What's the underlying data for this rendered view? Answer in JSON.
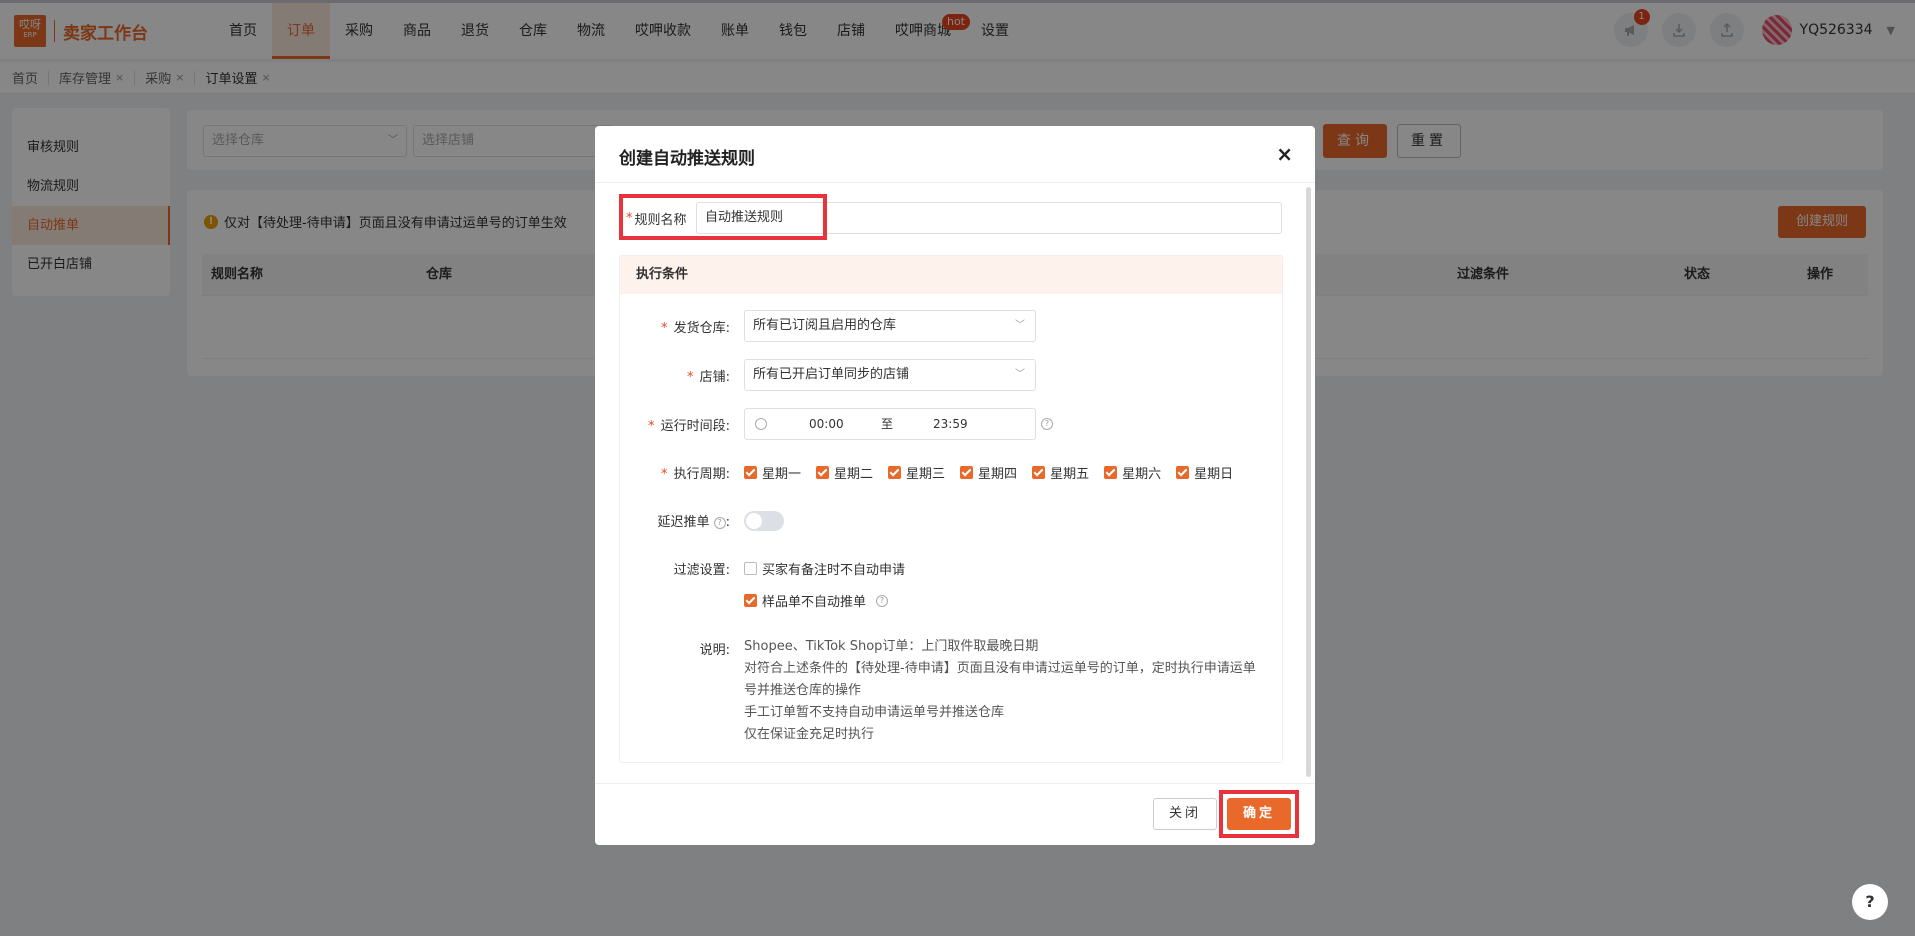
{
  "app": {
    "logo_badge": "哎呀",
    "logo_sub": "ERP",
    "title": "卖家工作台"
  },
  "nav": {
    "items": [
      {
        "label": "首页"
      },
      {
        "label": "订单"
      },
      {
        "label": "采购"
      },
      {
        "label": "商品"
      },
      {
        "label": "退货"
      },
      {
        "label": "仓库"
      },
      {
        "label": "物流"
      },
      {
        "label": "哎呷收款"
      },
      {
        "label": "账单"
      },
      {
        "label": "钱包"
      },
      {
        "label": "店铺"
      },
      {
        "label": "哎呷商城"
      },
      {
        "label": "设置"
      }
    ],
    "hot_badge": "hot",
    "notify_count": "1",
    "user": "YQ526334"
  },
  "tabs": [
    {
      "label": "首页"
    },
    {
      "label": "库存管理"
    },
    {
      "label": "采购"
    },
    {
      "label": "订单设置"
    }
  ],
  "tab_close": "×",
  "sidebar": {
    "items": [
      {
        "label": "审核规则"
      },
      {
        "label": "物流规则"
      },
      {
        "label": "自动推单"
      },
      {
        "label": "已开白店铺"
      }
    ]
  },
  "filter": {
    "warehouse_placeholder": "选择仓库",
    "shop_placeholder": "选择店铺",
    "query": "查询",
    "reset": "重置"
  },
  "table": {
    "notice": "仅对【待处理-待申请】页面且没有申请过运单号的订单生效",
    "create_button": "创建规则",
    "columns": [
      "规则名称",
      "仓库",
      "过滤条件",
      "状态",
      "操作"
    ]
  },
  "modal": {
    "title": "创建自动推送规则",
    "close_icon": "×",
    "name_label": "规则名称",
    "name_value": "自动推送规则",
    "section_title": "执行条件",
    "warehouse_label": "发货仓库:",
    "warehouse_value": "所有已订阅且启用的仓库",
    "shop_label": "店铺:",
    "shop_value": "所有已开启订单同步的店铺",
    "time_label": "运行时间段:",
    "time_start": "00:00",
    "time_sep": "至",
    "time_end": "23:59",
    "cycle_label": "执行周期:",
    "weekdays": [
      "星期一",
      "星期二",
      "星期三",
      "星期四",
      "星期五",
      "星期六",
      "星期日"
    ],
    "delay_label": "延迟推单",
    "delay_colon": ":",
    "filter_label": "过滤设置:",
    "filter_option_1": "买家有备注时不自动申请",
    "filter_option_2": "样品单不自动推单",
    "desc_label": "说明:",
    "desc_lines": [
      "Shopee、TikTok Shop订单：上门取件取最晚日期",
      "对符合上述条件的【待处理-待申请】页面且没有申请过运单号的订单，定时执行申请运单号并推送仓库的操作",
      "手工订单暂不支持自动申请运单号并推送仓库",
      "仅在保证金充足时执行"
    ],
    "close_button": "关闭",
    "confirm_button": "确定"
  },
  "help": "?",
  "colors": {
    "accent": "#e8692a",
    "highlight": "#e8323c",
    "overlay": "rgba(0,0,0,0.47)"
  }
}
